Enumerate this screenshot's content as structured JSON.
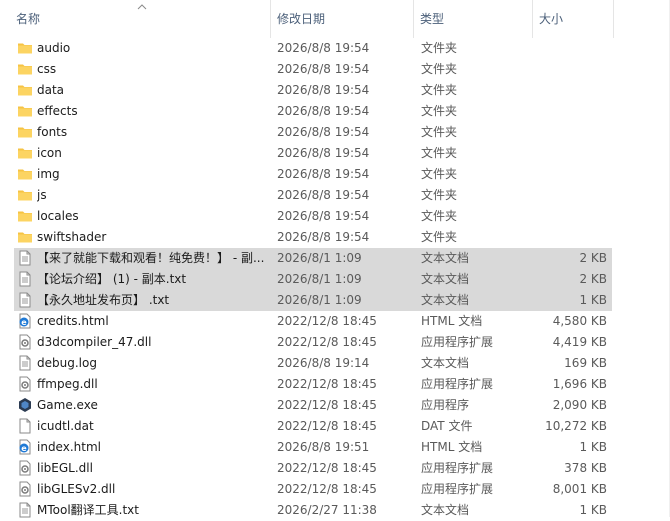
{
  "columns": {
    "name": "名称",
    "date": "修改日期",
    "type": "类型",
    "size": "大小"
  },
  "files": [
    {
      "name": "audio",
      "date": "2026/8/8 19:54",
      "type": "文件夹",
      "size": "",
      "icon": "folder-icon",
      "selected": false
    },
    {
      "name": "css",
      "date": "2026/8/8 19:54",
      "type": "文件夹",
      "size": "",
      "icon": "folder-icon",
      "selected": false
    },
    {
      "name": "data",
      "date": "2026/8/8 19:54",
      "type": "文件夹",
      "size": "",
      "icon": "folder-icon",
      "selected": false
    },
    {
      "name": "effects",
      "date": "2026/8/8 19:54",
      "type": "文件夹",
      "size": "",
      "icon": "folder-icon",
      "selected": false
    },
    {
      "name": "fonts",
      "date": "2026/8/8 19:54",
      "type": "文件夹",
      "size": "",
      "icon": "folder-icon",
      "selected": false
    },
    {
      "name": "icon",
      "date": "2026/8/8 19:54",
      "type": "文件夹",
      "size": "",
      "icon": "folder-icon",
      "selected": false
    },
    {
      "name": "img",
      "date": "2026/8/8 19:54",
      "type": "文件夹",
      "size": "",
      "icon": "folder-icon",
      "selected": false
    },
    {
      "name": "js",
      "date": "2026/8/8 19:54",
      "type": "文件夹",
      "size": "",
      "icon": "folder-icon",
      "selected": false
    },
    {
      "name": "locales",
      "date": "2026/8/8 19:54",
      "type": "文件夹",
      "size": "",
      "icon": "folder-icon",
      "selected": false
    },
    {
      "name": "swiftshader",
      "date": "2026/8/8 19:54",
      "type": "文件夹",
      "size": "",
      "icon": "folder-icon",
      "selected": false
    },
    {
      "name": "【来了就能下载和观看！纯免费！】 - 副...",
      "date": "2026/8/1 1:09",
      "type": "文本文档",
      "size": "2 KB",
      "icon": "text-file-icon",
      "selected": true
    },
    {
      "name": "【论坛介绍】 (1) - 副本.txt",
      "date": "2026/8/1 1:09",
      "type": "文本文档",
      "size": "2 KB",
      "icon": "text-file-icon",
      "selected": true
    },
    {
      "name": "【永久地址发布页】 .txt",
      "date": "2026/8/1 1:09",
      "type": "文本文档",
      "size": "1 KB",
      "icon": "text-file-icon",
      "selected": true
    },
    {
      "name": "credits.html",
      "date": "2022/12/8 18:45",
      "type": "HTML 文档",
      "size": "4,580 KB",
      "icon": "html-file-icon",
      "selected": false
    },
    {
      "name": "d3dcompiler_47.dll",
      "date": "2022/12/8 18:45",
      "type": "应用程序扩展",
      "size": "4,419 KB",
      "icon": "dll-file-icon",
      "selected": false
    },
    {
      "name": "debug.log",
      "date": "2026/8/8 19:14",
      "type": "文本文档",
      "size": "169 KB",
      "icon": "text-file-icon",
      "selected": false
    },
    {
      "name": "ffmpeg.dll",
      "date": "2022/12/8 18:45",
      "type": "应用程序扩展",
      "size": "1,696 KB",
      "icon": "dll-file-icon",
      "selected": false
    },
    {
      "name": "Game.exe",
      "date": "2022/12/8 18:45",
      "type": "应用程序",
      "size": "2,090 KB",
      "icon": "app-exe-icon",
      "selected": false
    },
    {
      "name": "icudtl.dat",
      "date": "2022/12/8 18:45",
      "type": "DAT 文件",
      "size": "10,272 KB",
      "icon": "blank-file-icon",
      "selected": false
    },
    {
      "name": "index.html",
      "date": "2026/8/8 19:51",
      "type": "HTML 文档",
      "size": "1 KB",
      "icon": "html-file-icon",
      "selected": false
    },
    {
      "name": "libEGL.dll",
      "date": "2022/12/8 18:45",
      "type": "应用程序扩展",
      "size": "378 KB",
      "icon": "dll-file-icon",
      "selected": false
    },
    {
      "name": "libGLESv2.dll",
      "date": "2022/12/8 18:45",
      "type": "应用程序扩展",
      "size": "8,001 KB",
      "icon": "dll-file-icon",
      "selected": false
    },
    {
      "name": "MTool翻译工具.txt",
      "date": "2026/2/27 11:38",
      "type": "文本文档",
      "size": "1 KB",
      "icon": "text-file-icon",
      "selected": false
    }
  ],
  "colors": {
    "selection": "#d9d9d9",
    "folder": "#f6c344",
    "header_text": "#4c607a"
  }
}
